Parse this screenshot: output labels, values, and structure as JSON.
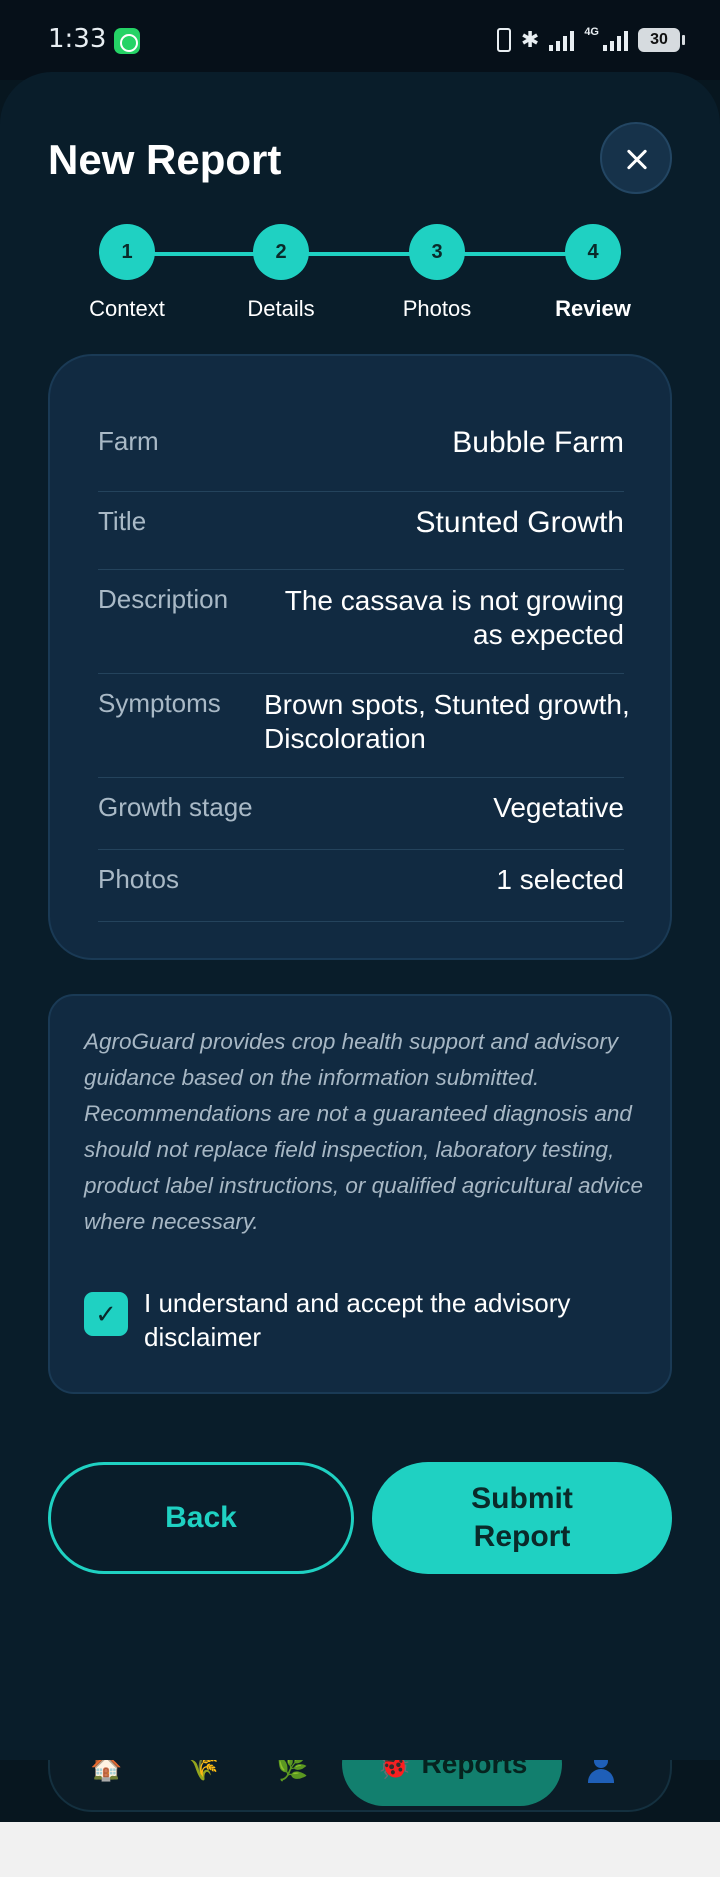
{
  "status_bar": {
    "time": "1:33",
    "network": "4G",
    "battery": "30"
  },
  "header": {
    "title": "New Report"
  },
  "stepper": {
    "steps": [
      {
        "number": "1",
        "label": "Context"
      },
      {
        "number": "2",
        "label": "Details"
      },
      {
        "number": "3",
        "label": "Photos"
      },
      {
        "number": "4",
        "label": "Review"
      }
    ],
    "active_step": "Review"
  },
  "summary": {
    "rows": [
      {
        "label": "Farm",
        "value": "Bubble Farm"
      },
      {
        "label": "Title",
        "value": "Stunted Growth"
      },
      {
        "label": "Description",
        "value": "The cassava is not growing as expected"
      },
      {
        "label": "Symptoms",
        "value": "Brown spots, Stunted growth, Discoloration"
      },
      {
        "label": "Growth stage",
        "value": "Vegetative"
      },
      {
        "label": "Photos",
        "value": "1 selected"
      }
    ]
  },
  "disclaimer": {
    "text": "AgroGuard provides crop health support and advisory guidance based on the information submitted. Recommendations are not a guaranteed diagnosis and should not replace field inspection, laboratory testing, product label instructions, or qualified agricultural advice where necessary.",
    "checkbox_label": "I understand and accept the advisory disclaimer",
    "checked": true,
    "check_glyph": "✓"
  },
  "actions": {
    "back_label": "Back",
    "submit_label": "Submit Report"
  },
  "bottom_nav": {
    "reports_label": "Reports",
    "icons": [
      "home-icon",
      "crop-icon",
      "leaf-icon",
      "ladybug-icon",
      "profile-icon"
    ]
  },
  "colors": {
    "accent": "#1fd1c2",
    "background": "#091d2a",
    "card": "#112a41"
  }
}
